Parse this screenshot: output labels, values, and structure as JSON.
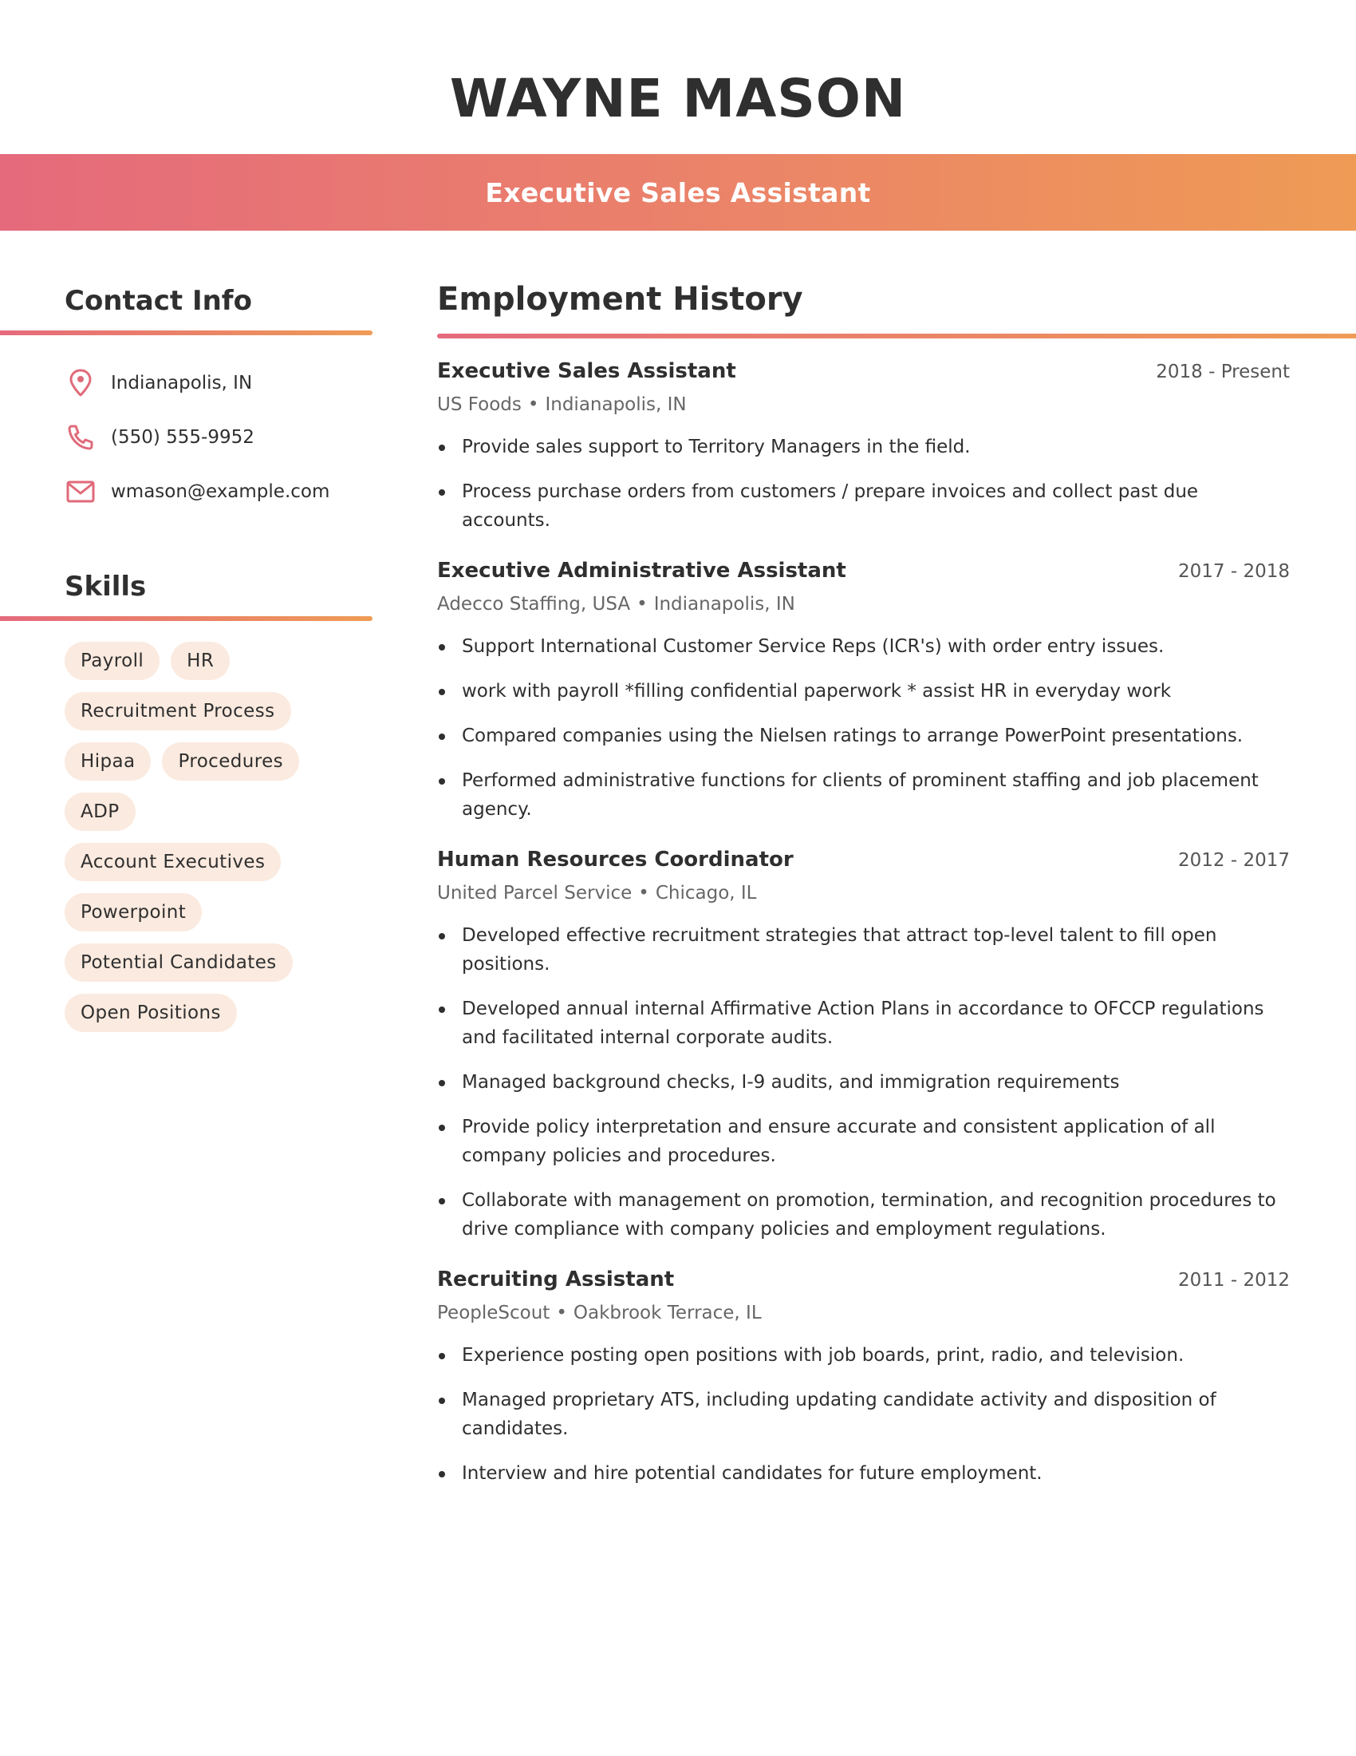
{
  "header": {
    "name": "WAYNE MASON",
    "job_title": "Executive Sales Assistant"
  },
  "colors": {
    "gradient_start": "#e56a7c",
    "gradient_end": "#ef9b55",
    "chip_background": "#fbeadf",
    "icon_color": "#e06a7a",
    "text": "#2f2f2f"
  },
  "contact": {
    "title": "Contact Info",
    "items": [
      {
        "icon": "map-pin-icon",
        "text": "Indianapolis, IN"
      },
      {
        "icon": "phone-icon",
        "text": "(550) 555-9952"
      },
      {
        "icon": "mail-icon",
        "text": "wmason@example.com"
      }
    ]
  },
  "skills": {
    "title": "Skills",
    "items": [
      "Payroll",
      "HR",
      "Recruitment Process",
      "Hipaa",
      "Procedures",
      "ADP",
      "Account Executives",
      "Powerpoint",
      "Potential Candidates",
      "Open Positions"
    ]
  },
  "employment": {
    "title": "Employment History",
    "separator": "•",
    "jobs": [
      {
        "title": "Executive Sales Assistant",
        "dates": "2018 - Present",
        "company": "US Foods",
        "location": "Indianapolis, IN",
        "bullets": [
          "Provide sales support to Territory Managers in the field.",
          "Process purchase orders from customers / prepare invoices and collect past due accounts."
        ]
      },
      {
        "title": "Executive Administrative Assistant",
        "dates": "2017 - 2018",
        "company": "Adecco Staffing, USA",
        "location": "Indianapolis, IN",
        "bullets": [
          "Support International Customer Service Reps (ICR's) with order entry issues.",
          "work with payroll *filling confidential paperwork * assist HR in everyday work",
          "Compared companies using the Nielsen ratings to arrange PowerPoint presentations.",
          "Performed administrative functions for clients of prominent staffing and job placement agency."
        ]
      },
      {
        "title": "Human Resources Coordinator",
        "dates": "2012 - 2017",
        "company": "United Parcel Service",
        "location": "Chicago, IL",
        "bullets": [
          "Developed effective recruitment strategies that attract top-level talent to fill open positions.",
          "Developed annual internal Affirmative Action Plans in accordance to OFCCP regulations and facilitated internal corporate audits.",
          "Managed background checks, I-9 audits, and immigration requirements",
          "Provide policy interpretation and ensure accurate and consistent application of all company policies and procedures.",
          "Collaborate with management on promotion, termination, and recognition procedures to drive compliance with company policies and employment regulations."
        ]
      },
      {
        "title": "Recruiting Assistant",
        "dates": "2011 - 2012",
        "company": "PeopleScout",
        "location": "Oakbrook Terrace, IL",
        "bullets": [
          "Experience posting open positions with job boards, print, radio, and television.",
          "Managed proprietary ATS, including updating candidate activity and disposition of candidates.",
          "Interview and hire potential candidates for future employment."
        ]
      }
    ]
  }
}
